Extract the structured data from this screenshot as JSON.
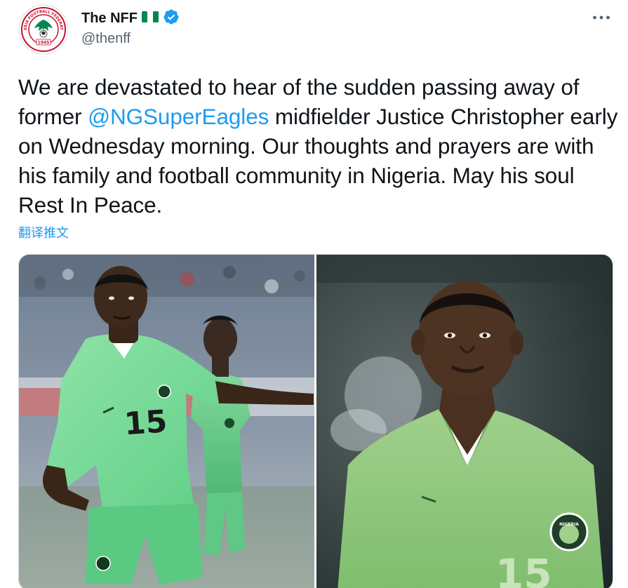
{
  "author": {
    "display_name": "The NFF",
    "handle": "@thenff",
    "verified": true,
    "flag": "nigeria-flag-emoji",
    "avatar": "nigeria-football-federation-logo",
    "avatar_text": "NIGERIA FOOTBALL FEDERATION",
    "avatar_year": "1945"
  },
  "tweet": {
    "text_before": "We are devastated to hear of the sudden passing away of former ",
    "mention": "@NGSuperEagles",
    "text_after": " midfielder Justice Christopher early on Wednesday morning. Our thoughts and prayers are with his family and football community in Nigeria. May his soul Rest In Peace.",
    "translate_label": "翻译推文"
  },
  "media": {
    "photos": [
      {
        "subject": "player in green Nigeria kit number 15 during a match",
        "jersey_number": "15"
      },
      {
        "subject": "portrait of player in light green Nigeria kit number 15",
        "jersey_number": "15",
        "badge_text": "NIGERIA"
      }
    ]
  },
  "colors": {
    "accent": "#1d9bf0",
    "text": "#0f1419",
    "secondary_text": "#536471",
    "border": "#cfd9de",
    "nigeria_green": "#008751"
  },
  "icons": {
    "more": "more-horizontal-icon",
    "verified": "verified-badge-icon"
  }
}
